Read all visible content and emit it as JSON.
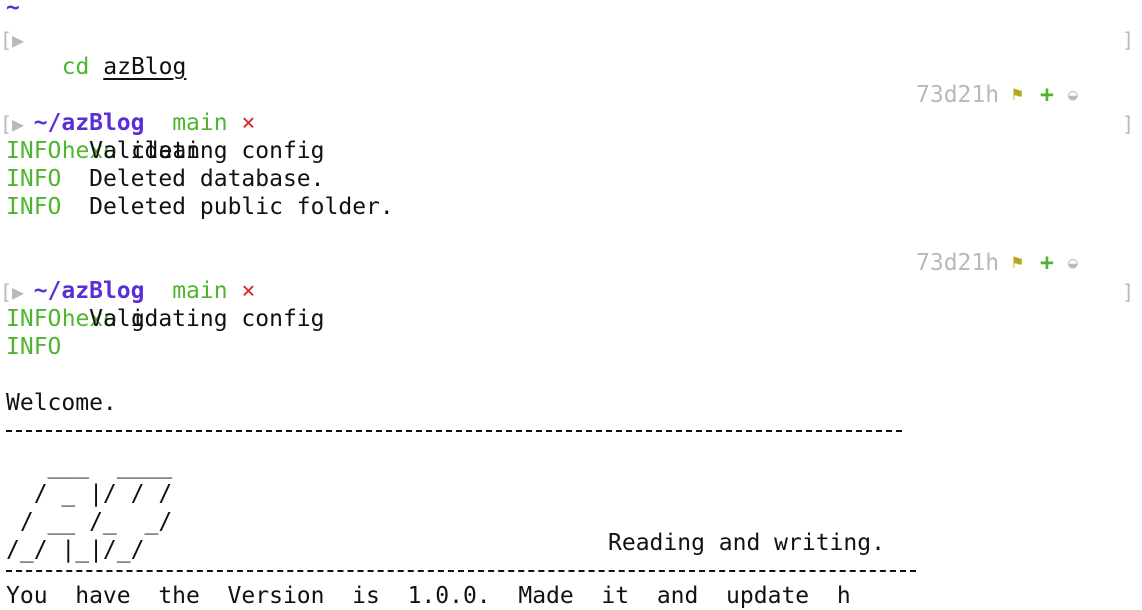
{
  "colors": {
    "path": "#5b2fd6",
    "branch": "#4fb52f",
    "dirty": "#d12c2c",
    "muted": "#b9b9b9"
  },
  "top_tilde": "~",
  "line1": {
    "marker": "[▶",
    "cmd": "cd",
    "arg": "azBlog",
    "right_bracket": "]"
  },
  "block2": {
    "path": "~/azBlog",
    "branch": "main",
    "dirty_mark": "×",
    "timer": "73d21h",
    "flag_icon": "⚑",
    "plus_icon": "+",
    "circle_icon": "◒",
    "marker": "[▶",
    "cmd": "hexo",
    "arg": "clean",
    "right_bracket": "]",
    "logs": [
      {
        "level": "INFO",
        "text": "Validating config"
      },
      {
        "level": "INFO",
        "text": "Deleted database."
      },
      {
        "level": "INFO",
        "text": "Deleted public folder."
      }
    ]
  },
  "block3": {
    "path": "~/azBlog",
    "branch": "main",
    "dirty_mark": "×",
    "timer": "73d21h",
    "flag_icon": "⚑",
    "plus_icon": "+",
    "circle_icon": "◒",
    "marker": "[▶",
    "cmd": "hexo",
    "arg": "g",
    "right_bracket": "]",
    "logs": [
      {
        "level": "INFO",
        "text": "Validating config"
      },
      {
        "level": "INFO",
        "text": ""
      }
    ]
  },
  "welcome": "Welcome.",
  "ascii_art": "   ___  ____\n  / _ |/ / /\n / __ /_  _/\n/_/ |_|/_/",
  "tagline": "Reading and writing.",
  "cut_line": "You  have  the  Version  is  1.0.0.  Made  it  and  update  h"
}
